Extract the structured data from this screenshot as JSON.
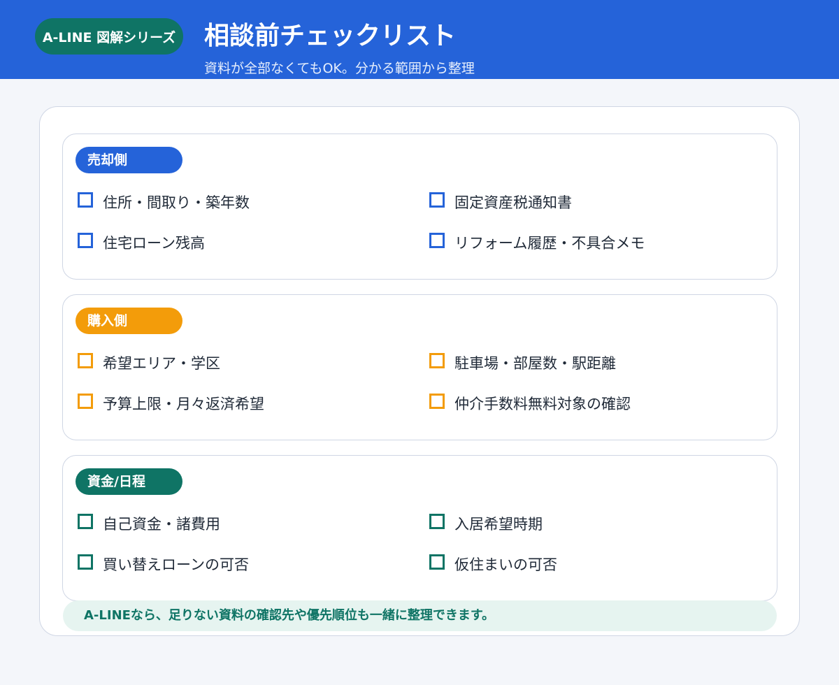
{
  "header": {
    "badge": "A-LINE 図解シリーズ",
    "title": "相談前チェックリスト",
    "subtitle": "資料が全部なくてもOK。分かる範囲から整理"
  },
  "colors": {
    "header_bg": "#2563d9",
    "brand_green": "#0f7465",
    "sell_blue": "#2563d9",
    "buy_orange": "#f39c0a",
    "funds_green": "#0f7465",
    "footer_bg": "#e6f4f0"
  },
  "sections": [
    {
      "tag": "売却側",
      "color": "#2563d9",
      "items": [
        "住所・間取り・築年数",
        "固定資産税通知書",
        "住宅ローン残高",
        "リフォーム履歴・不具合メモ"
      ],
      "checked": [
        false,
        false,
        false,
        false
      ]
    },
    {
      "tag": "購入側",
      "color": "#f39c0a",
      "items": [
        "希望エリア・学区",
        "駐車場・部屋数・駅距離",
        "予算上限・月々返済希望",
        "仲介手数料無料対象の確認"
      ],
      "checked": [
        false,
        false,
        false,
        false
      ]
    },
    {
      "tag": "資金/日程",
      "color": "#0f7465",
      "items": [
        "自己資金・諸費用",
        "入居希望時期",
        "買い替えローンの可否",
        "仮住まいの可否"
      ],
      "checked": [
        false,
        false,
        false,
        false
      ]
    }
  ],
  "footer": {
    "note": "A-LINEなら、足りない資料の確認先や優先順位も一緒に整理できます。"
  }
}
